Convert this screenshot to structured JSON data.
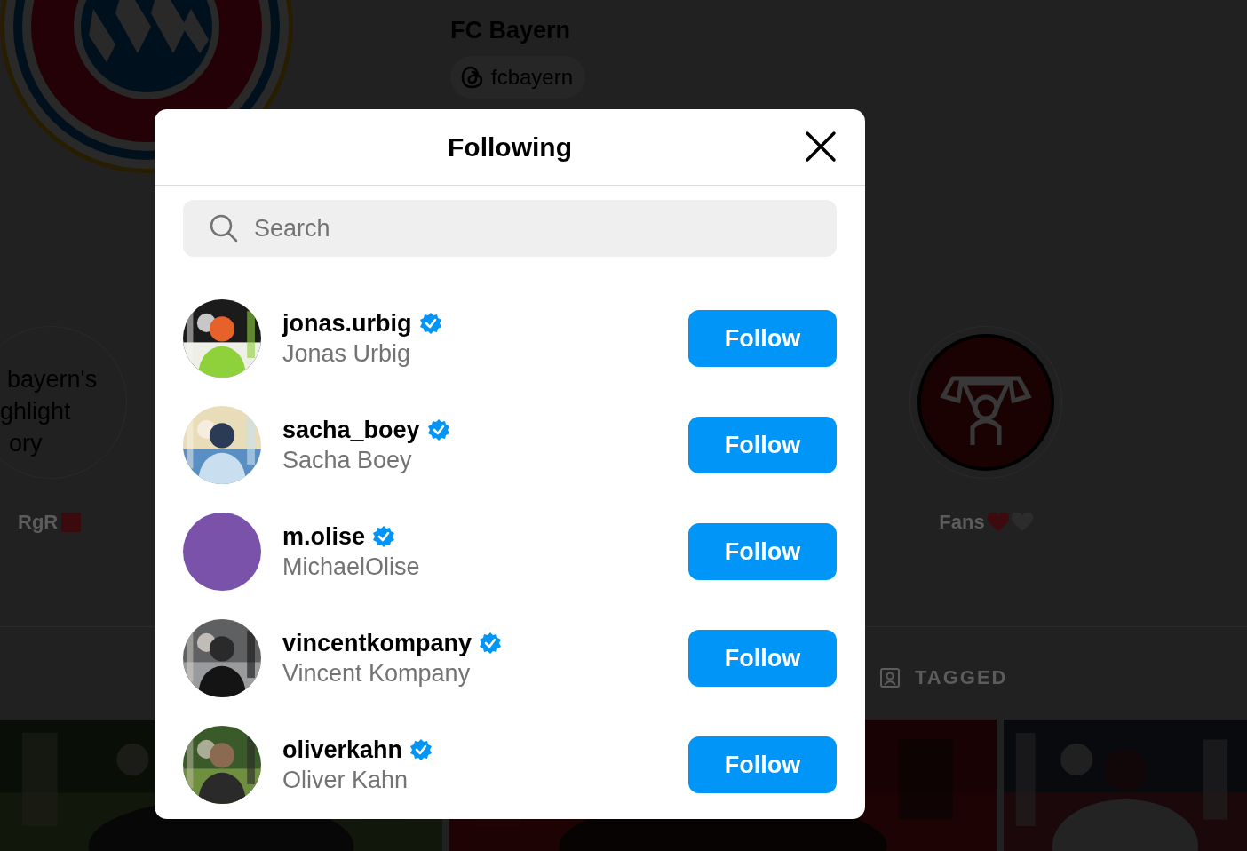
{
  "profile": {
    "name": "FC Bayern",
    "threads_handle": "fcbayern"
  },
  "highlights": [
    {
      "label": "RgR",
      "cover_lines": [
        "bayern's",
        "ghlight",
        "ory"
      ],
      "kind": "text",
      "marks": [
        {
          "kind": "square",
          "color": "#3b0a0c"
        }
      ]
    },
    {
      "label": "Fans",
      "kind": "icon",
      "marks": [
        {
          "kind": "heart",
          "color": "#3d0b0e"
        },
        {
          "kind": "heart",
          "color": "#2c2c2c"
        }
      ]
    }
  ],
  "tabs": [
    {
      "label": "TAGGED",
      "selected": false
    }
  ],
  "dialog": {
    "title": "Following",
    "search": {
      "placeholder": "Search"
    },
    "users": [
      {
        "username": "jonas.urbig",
        "full_name": "Jonas Urbig",
        "verified": true,
        "button": "Follow"
      },
      {
        "username": "sacha_boey",
        "full_name": "Sacha Boey",
        "verified": true,
        "button": "Follow"
      },
      {
        "username": "m.olise",
        "full_name": "MichaelOlise",
        "verified": true,
        "avatar": {
          "kind": "plain",
          "color": "#7a52aa"
        },
        "button": "Follow"
      },
      {
        "username": "vincentkompany",
        "full_name": "Vincent Kompany",
        "verified": true,
        "button": "Follow"
      },
      {
        "username": "oliverkahn",
        "full_name": "Oliver Kahn",
        "verified": true,
        "button": "Follow"
      }
    ]
  }
}
